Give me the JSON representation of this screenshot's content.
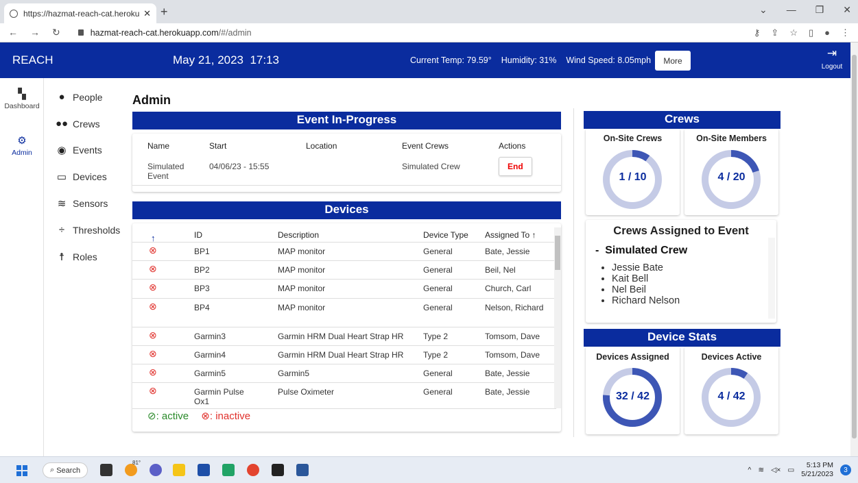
{
  "browser": {
    "tab_title": "https://hazmat-reach-cat.herokuap",
    "url_host": "hazmat-reach-cat.herokuapp.com",
    "url_path": "/#/admin"
  },
  "header": {
    "brand": "REACH",
    "date": "May 21, 2023",
    "time": "17:13",
    "temp": "Current Temp: 79.59°",
    "humidity": "Humidity: 31%",
    "wind": "Wind Speed: 8.05mph",
    "more": "More",
    "logout": "Logout"
  },
  "rail": {
    "dashboard": "Dashboard",
    "admin": "Admin"
  },
  "menu": [
    "People",
    "Crews",
    "Events",
    "Devices",
    "Sensors",
    "Thresholds",
    "Roles"
  ],
  "page_title": "Admin",
  "event": {
    "banner": "Event In-Progress",
    "headers": [
      "Name",
      "Start",
      "Location",
      "Event Crews",
      "Actions"
    ],
    "name": "Simulated Event",
    "start": "04/06/23 - 15:55",
    "location": "",
    "crews": "Simulated Crew",
    "action": "End"
  },
  "devices": {
    "banner": "Devices",
    "headers": [
      "ID",
      "Description",
      "Device Type",
      "Assigned To"
    ],
    "rows": [
      {
        "id": "BP1",
        "desc": "MAP monitor",
        "type": "General",
        "assigned": "Bate, Jessie"
      },
      {
        "id": "BP2",
        "desc": "MAP monitor",
        "type": "General",
        "assigned": "Beil, Nel"
      },
      {
        "id": "BP3",
        "desc": "MAP monitor",
        "type": "General",
        "assigned": "Church, Carl"
      },
      {
        "id": "BP4",
        "desc": "MAP monitor",
        "type": "General",
        "assigned": "Nelson, Richard"
      },
      {
        "id": "Garmin3",
        "desc": "Garmin HRM Dual Heart Strap HR",
        "type": "Type 2",
        "assigned": "Tomsom, Dave"
      },
      {
        "id": "Garmin4",
        "desc": "Garmin HRM Dual Heart Strap HR",
        "type": "Type 2",
        "assigned": "Tomsom, Dave"
      },
      {
        "id": "Garmin5",
        "desc": "Garmin5",
        "type": "General",
        "assigned": "Bate, Jessie"
      },
      {
        "id": "Garmin Pulse Ox1",
        "desc": "Pulse Oximeter",
        "type": "General",
        "assigned": "Bate, Jessie"
      }
    ],
    "legend_active": ": active",
    "legend_inactive": ": inactive"
  },
  "crews": {
    "banner": "Crews",
    "onsite_crews_label": "On-Site Crews",
    "onsite_crews": "1 / 10",
    "onsite_crews_fraction": 0.1,
    "onsite_members_label": "On-Site Members",
    "onsite_members": "4 / 20",
    "onsite_members_fraction": 0.2,
    "assigned_title": "Crews Assigned to Event",
    "crew_name": "Simulated Crew",
    "members": [
      "Jessie Bate",
      "Kait Bell",
      "Nel Beil",
      "Richard Nelson"
    ]
  },
  "device_stats": {
    "banner": "Device Stats",
    "assigned_label": "Devices Assigned",
    "assigned": "32 / 42",
    "assigned_fraction": 0.762,
    "active_label": "Devices Active",
    "active": "4 / 42",
    "active_fraction": 0.095
  },
  "taskbar": {
    "search": "Search",
    "weather": "81°",
    "time": "5:13 PM",
    "date": "5/21/2023",
    "notifications": "3"
  },
  "colors": {
    "brand": "#0a2c9e",
    "donut_fill": "#3d56b5",
    "donut_track": "#c5cbe6",
    "inactive": "#e0302b",
    "active": "#2a8a2a"
  }
}
